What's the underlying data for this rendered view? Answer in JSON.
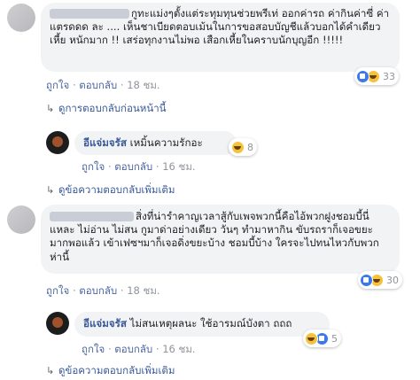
{
  "comment1": {
    "text": "กูทะแม่งๆตั้งแต่ระทุมทุนช่วยพรีเท่ ออกค่ารถ ค่ากินค่าซี่ ค่าแตรดดด ละ .... เห็นชาเบียดตอบเม้นในการขอสอบบัญชีแล้วบอกได้คำเดียว เหี้ย หนักมาก !! เสร่อทุกงานไม่พอ เสือกเหี้ยในคราบนักบุญอีก !!!!!",
    "reaction_count": "33",
    "like_label": "ถูกใจ",
    "reply_label": "ตอบกลับ",
    "time": "18 ชม.",
    "prev_replies_label": "ดูการตอบกลับก่อนหน้านี้"
  },
  "reply1": {
    "author": "อีแจ่มจรัส",
    "text": "เหมิ้นความรักอะ",
    "reaction_count": "8",
    "like_label": "ถูกใจ",
    "reply_label": "ตอบกลับ",
    "time": "16 ชม.",
    "more_label": "ดูข้อความตอบกลับเพิ่มเติม"
  },
  "comment2": {
    "text": "สิ่งที่น่ารำคาญเวลาสู้กับเพจพวกนี้คือไอ้พวกฝูงชอมบี้นี่แหละ ไม่อ่าน ไม่สน กูมาด่าอย่างเดียว วันๆ ทำมาหากิน ขับรถราก็เจอขยะมากพอแล้ว เข้าเฟซฯมาก็เจอดิ่งขยะบ้าง ชอมบี้บ้าง ใครจะไปทนไหวกับพวกห่านี้",
    "reaction_count": "30",
    "like_label": "ถูกใจ",
    "reply_label": "ตอบกลับ",
    "time": "18 ชม."
  },
  "reply2": {
    "author": "อีแจ่มจรัส",
    "text": "ไม่สนเหตุผลนะ ใช้อารมณ์บังตา ถถถ",
    "reaction_count": "5",
    "like_label": "ถูกใจ",
    "reply_label": "ตอบกลับ",
    "time": "16 ชม.",
    "more_label": "ดูข้อความตอบกลับเพิ่มเติม"
  },
  "separator": "·",
  "icons": {
    "like": "like-reaction-icon",
    "haha": "haha-reaction-icon",
    "reply_arrow": "reply-arrow-icon"
  },
  "colors": {
    "link": "#385898",
    "bubble": "#f2f3f5",
    "meta": "#90949c"
  }
}
